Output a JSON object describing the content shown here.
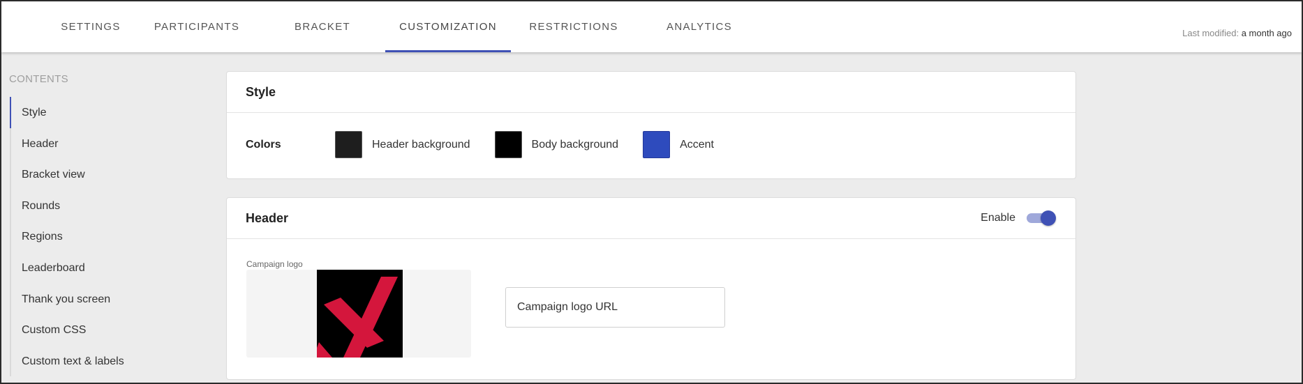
{
  "tabs": [
    {
      "label": "SETTINGS"
    },
    {
      "label": "PARTICIPANTS"
    },
    {
      "label": "BRACKET"
    },
    {
      "label": "CUSTOMIZATION",
      "active": true
    },
    {
      "label": "RESTRICTIONS"
    },
    {
      "label": "ANALYTICS"
    }
  ],
  "last_modified": {
    "label": "Last modified:",
    "value": "a month ago"
  },
  "sidebar": {
    "title": "CONTENTS",
    "items": [
      {
        "label": "Style"
      },
      {
        "label": "Header"
      },
      {
        "label": "Bracket view"
      },
      {
        "label": "Rounds"
      },
      {
        "label": "Regions"
      },
      {
        "label": "Leaderboard"
      },
      {
        "label": "Thank you screen"
      },
      {
        "label": "Custom CSS"
      },
      {
        "label": "Custom text & labels"
      }
    ]
  },
  "style_card": {
    "title": "Style",
    "colors_label": "Colors",
    "swatches": [
      {
        "label": "Header background",
        "color": "#1e1e1e"
      },
      {
        "label": "Body background",
        "color": "#000000"
      },
      {
        "label": "Accent",
        "color": "#2e4bbd"
      }
    ]
  },
  "header_card": {
    "title": "Header",
    "enable_label": "Enable",
    "enabled": true,
    "logo_label": "Campaign logo",
    "logo_url_label": "Campaign logo URL"
  },
  "colors": {
    "accent": "#3f51b5",
    "logo_red": "#d4163c"
  }
}
